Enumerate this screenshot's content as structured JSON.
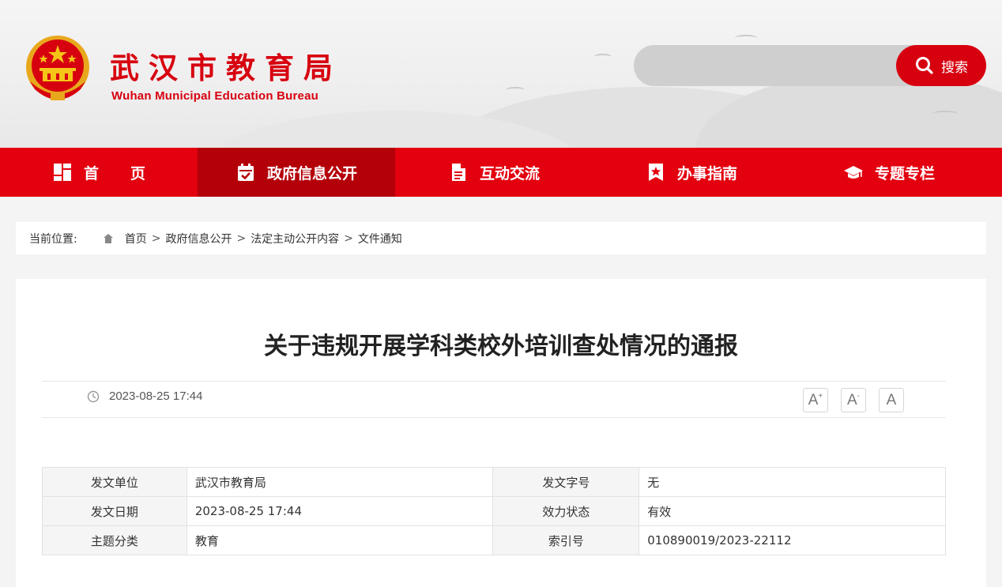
{
  "header": {
    "title": "武汉市教育局",
    "subtitle": "Wuhan Municipal Education Bureau",
    "emblem_icon": "national-emblem-icon",
    "search": {
      "placeholder": "",
      "button_label": "搜索",
      "icon": "search-icon"
    }
  },
  "nav": {
    "items": [
      {
        "label": "首页",
        "icon": "grid-icon"
      },
      {
        "label": "政府信息公开",
        "icon": "calendar-check-icon"
      },
      {
        "label": "互动交流",
        "icon": "document-icon"
      },
      {
        "label": "办事指南",
        "icon": "bookmark-star-icon"
      },
      {
        "label": "专题专栏",
        "icon": "graduation-cap-icon"
      }
    ]
  },
  "breadcrumb": {
    "prefix": "当前位置:",
    "items": [
      "首页",
      "政府信息公开",
      "法定主动公开内容",
      "文件通知"
    ],
    "separator": ">"
  },
  "article": {
    "title": "关于违规开展学科类校外培训查处情况的通报",
    "date": "2023-08-25 17:44",
    "font_controls": [
      "A",
      "A",
      "A"
    ]
  },
  "info_table": {
    "rows": [
      {
        "label1": "发文单位",
        "value1": "武汉市教育局",
        "label2": "发文字号",
        "value2": "无"
      },
      {
        "label1": "发文日期",
        "value1": "2023-08-25 17:44",
        "label2": "效力状态",
        "value2": "有效"
      },
      {
        "label1": "主题分类",
        "value1": "教育",
        "label2": "索引号",
        "value2": "010890019/2023-22112"
      }
    ]
  },
  "colors": {
    "brand_red": "#e3000f",
    "active_red": "#b40009",
    "title_red": "#d7000f"
  }
}
